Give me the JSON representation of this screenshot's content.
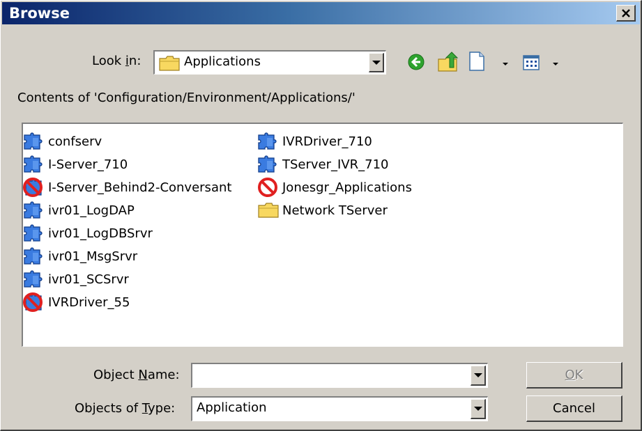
{
  "window": {
    "title": "Browse",
    "close_glyph": "×"
  },
  "lookin": {
    "label_pre": "Look ",
    "label_acc": "i",
    "label_post": "n:",
    "value": "Applications",
    "icon": "folder-icon"
  },
  "toolbar": {
    "icons": [
      "back-green-icon",
      "up-folder-icon",
      "new-item-icon",
      "view-menu-icon"
    ]
  },
  "contents_label": "Contents of 'Configuration/Environment/Applications/'",
  "list": {
    "columns": [
      [
        {
          "label": "confserv",
          "icon": "application-icon"
        },
        {
          "label": "I-Server_710",
          "icon": "application-icon"
        },
        {
          "label": "I-Server_Behind2-Conversant",
          "icon": "disabled-application-icon"
        },
        {
          "label": "ivr01_LogDAP",
          "icon": "application-icon"
        },
        {
          "label": "ivr01_LogDBSrvr",
          "icon": "application-icon"
        },
        {
          "label": "ivr01_MsgSrvr",
          "icon": "application-icon"
        },
        {
          "label": "ivr01_SCSrvr",
          "icon": "application-icon"
        },
        {
          "label": "IVRDriver_55",
          "icon": "disabled-application-icon"
        }
      ],
      [
        {
          "label": "IVRDriver_710",
          "icon": "application-icon"
        },
        {
          "label": "TServer_IVR_710",
          "icon": "application-icon"
        },
        {
          "label": "Jonesgr_Applications",
          "icon": "disabled-folder-icon"
        },
        {
          "label": "Network TServer",
          "icon": "folder-icon"
        }
      ]
    ]
  },
  "object_name": {
    "label_pre": "Object ",
    "label_acc": "N",
    "label_post": "ame:",
    "value": ""
  },
  "object_type": {
    "label_pre": "Objects of ",
    "label_acc": "T",
    "label_post": "ype:",
    "value": "Application"
  },
  "buttons": {
    "ok_acc": "O",
    "ok_rest": "K",
    "cancel": "Cancel"
  },
  "colors": {
    "titlebar_start": "#0a246a",
    "titlebar_end": "#a6caf0",
    "dialog_face": "#d4d0c8",
    "app_icon_blue": "#3a7be0",
    "disabled_red": "#e02020",
    "folder_yellow": "#f8d860"
  }
}
